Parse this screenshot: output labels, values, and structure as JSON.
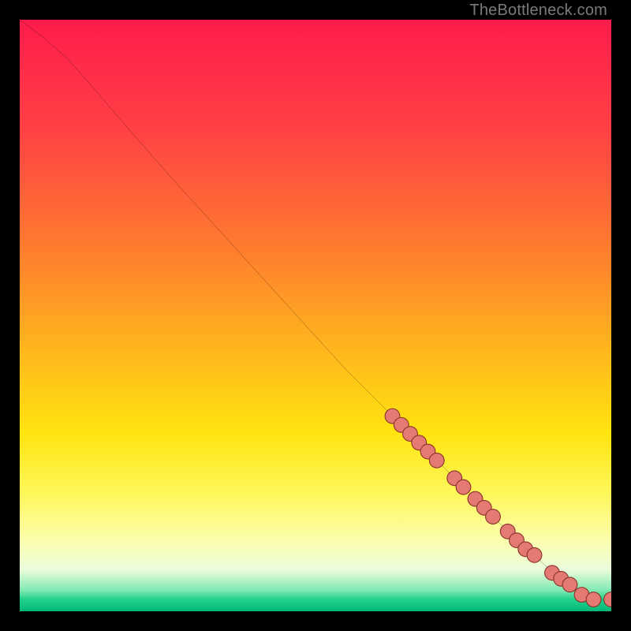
{
  "attribution": "TheBottleneck.com",
  "colors": {
    "marker_fill": "#e47a72",
    "marker_stroke": "#8a332c",
    "line": "#000000",
    "frame": "#000000"
  },
  "gradient_stops": [
    {
      "pct": 0,
      "color": "#ff1c4b"
    },
    {
      "pct": 18,
      "color": "#ff3f45"
    },
    {
      "pct": 38,
      "color": "#ff7a2f"
    },
    {
      "pct": 55,
      "color": "#ffb41e"
    },
    {
      "pct": 70,
      "color": "#ffe40f"
    },
    {
      "pct": 80,
      "color": "#fdf75a"
    },
    {
      "pct": 88,
      "color": "#fdfeae"
    },
    {
      "pct": 93,
      "color": "#eafcdb"
    },
    {
      "pct": 96.5,
      "color": "#7fe9b2"
    },
    {
      "pct": 98,
      "color": "#1fd18b"
    },
    {
      "pct": 100,
      "color": "#05b877"
    }
  ],
  "chart_data": {
    "type": "line",
    "title": "",
    "xlabel": "",
    "ylabel": "",
    "xlim": [
      0,
      100
    ],
    "ylim": [
      0,
      100
    ],
    "series": [
      {
        "name": "curve",
        "x": [
          0,
          4,
          8,
          12,
          18,
          25,
          35,
          45,
          55,
          63,
          70,
          76,
          80,
          84,
          87,
          89,
          91,
          93,
          95,
          97,
          100
        ],
        "y": [
          100,
          97,
          93.5,
          89,
          82,
          74,
          63,
          52,
          41,
          33,
          26,
          20,
          16,
          12,
          9.5,
          7.6,
          6,
          4.5,
          2.8,
          2,
          2
        ]
      }
    ],
    "markers": [
      {
        "x": 63.0,
        "y": 33.0
      },
      {
        "x": 64.5,
        "y": 31.5
      },
      {
        "x": 66.0,
        "y": 30.0
      },
      {
        "x": 67.5,
        "y": 28.5
      },
      {
        "x": 69.0,
        "y": 27.0
      },
      {
        "x": 70.5,
        "y": 25.5
      },
      {
        "x": 73.5,
        "y": 22.5
      },
      {
        "x": 75.0,
        "y": 21.0
      },
      {
        "x": 77.0,
        "y": 19.0
      },
      {
        "x": 78.5,
        "y": 17.5
      },
      {
        "x": 80.0,
        "y": 16.0
      },
      {
        "x": 82.5,
        "y": 13.5
      },
      {
        "x": 84.0,
        "y": 12.0
      },
      {
        "x": 85.5,
        "y": 10.5
      },
      {
        "x": 87.0,
        "y": 9.5
      },
      {
        "x": 90.0,
        "y": 6.5
      },
      {
        "x": 91.5,
        "y": 5.5
      },
      {
        "x": 93.0,
        "y": 4.5
      },
      {
        "x": 95.0,
        "y": 2.8
      },
      {
        "x": 97.0,
        "y": 2.0
      },
      {
        "x": 100.0,
        "y": 2.0
      }
    ]
  }
}
